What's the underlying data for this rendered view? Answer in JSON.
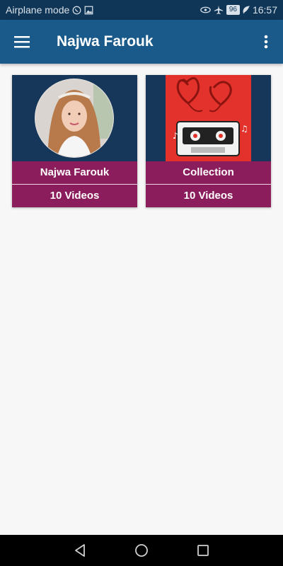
{
  "status_bar": {
    "left_text": "Airplane mode",
    "battery": "96",
    "time": "16:57"
  },
  "app_bar": {
    "title": "Najwa Farouk"
  },
  "cards": [
    {
      "title": "Najwa Farouk",
      "count": "10 Videos",
      "image": "singer-portrait"
    },
    {
      "title": "Collection",
      "count": "10 Videos",
      "image": "cassette-hearts"
    }
  ],
  "colors": {
    "status_bar": "#0f3557",
    "app_bar": "#1a5a8a",
    "card_label": "#8c1d5c",
    "thumb_bg": "#16375a",
    "page_bg": "#f7f7f7"
  },
  "icons": [
    "whatsapp-icon",
    "image-icon",
    "eye-icon",
    "airplane-icon",
    "leaf-icon",
    "menu-icon",
    "more-vert-icon",
    "back-icon",
    "home-icon",
    "recents-icon"
  ]
}
